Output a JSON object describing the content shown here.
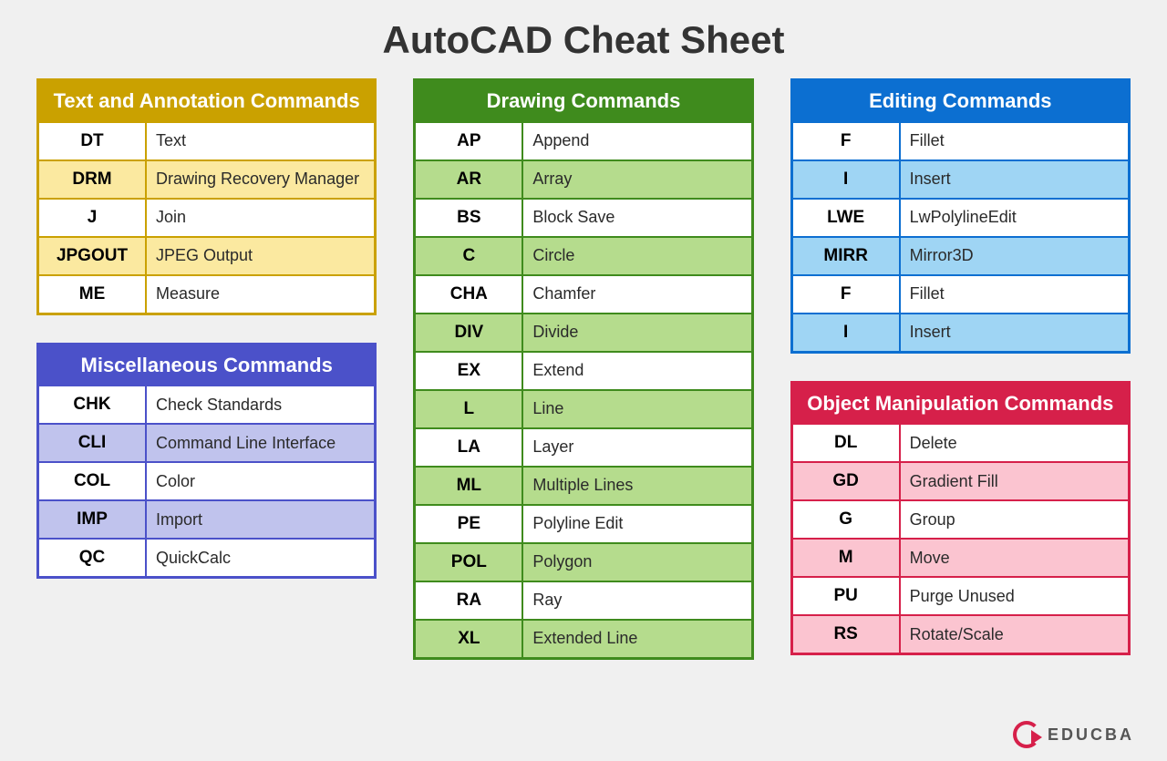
{
  "title": "AutoCAD Cheat Sheet",
  "logo_text": "EDUCBA",
  "sections": [
    {
      "id": "text-annotation",
      "title": "Text and Annotation Commands",
      "color": "yellow",
      "rows": [
        {
          "cmd": "DT",
          "desc": "Text"
        },
        {
          "cmd": "DRM",
          "desc": "Drawing Recovery Manager"
        },
        {
          "cmd": "J",
          "desc": "Join"
        },
        {
          "cmd": "JPGOUT",
          "desc": "JPEG Output"
        },
        {
          "cmd": "ME",
          "desc": "Measure"
        }
      ]
    },
    {
      "id": "misc",
      "title": "Miscellaneous Commands",
      "color": "purple",
      "rows": [
        {
          "cmd": "CHK",
          "desc": "Check Standards"
        },
        {
          "cmd": "CLI",
          "desc": "Command Line Interface"
        },
        {
          "cmd": "COL",
          "desc": "Color"
        },
        {
          "cmd": "IMP",
          "desc": "Import"
        },
        {
          "cmd": "QC",
          "desc": "QuickCalc"
        }
      ]
    },
    {
      "id": "drawing",
      "title": "Drawing Commands",
      "color": "green",
      "rows": [
        {
          "cmd": "AP",
          "desc": "Append"
        },
        {
          "cmd": "AR",
          "desc": "Array"
        },
        {
          "cmd": "BS",
          "desc": "Block Save"
        },
        {
          "cmd": "C",
          "desc": "Circle"
        },
        {
          "cmd": "CHA",
          "desc": "Chamfer"
        },
        {
          "cmd": "DIV",
          "desc": "Divide"
        },
        {
          "cmd": "EX",
          "desc": "Extend"
        },
        {
          "cmd": "L",
          "desc": "Line"
        },
        {
          "cmd": "LA",
          "desc": "Layer"
        },
        {
          "cmd": "ML",
          "desc": "Multiple Lines"
        },
        {
          "cmd": "PE",
          "desc": "Polyline Edit"
        },
        {
          "cmd": "POL",
          "desc": "Polygon"
        },
        {
          "cmd": "RA",
          "desc": "Ray"
        },
        {
          "cmd": "XL",
          "desc": "Extended Line"
        }
      ]
    },
    {
      "id": "editing",
      "title": "Editing Commands",
      "color": "blue",
      "rows": [
        {
          "cmd": "F",
          "desc": "Fillet"
        },
        {
          "cmd": "I",
          "desc": "Insert"
        },
        {
          "cmd": "LWE",
          "desc": "LwPolylineEdit"
        },
        {
          "cmd": "MIRR",
          "desc": "Mirror3D"
        },
        {
          "cmd": "F",
          "desc": "Fillet"
        },
        {
          "cmd": "I",
          "desc": "Insert"
        }
      ]
    },
    {
      "id": "object-manipulation",
      "title": "Object Manipulation Commands",
      "color": "pink",
      "rows": [
        {
          "cmd": "DL",
          "desc": "Delete"
        },
        {
          "cmd": "GD",
          "desc": "Gradient Fill"
        },
        {
          "cmd": "G",
          "desc": "Group"
        },
        {
          "cmd": "M",
          "desc": "Move"
        },
        {
          "cmd": "PU",
          "desc": "Purge Unused"
        },
        {
          "cmd": "RS",
          "desc": "Rotate/Scale"
        }
      ]
    }
  ]
}
